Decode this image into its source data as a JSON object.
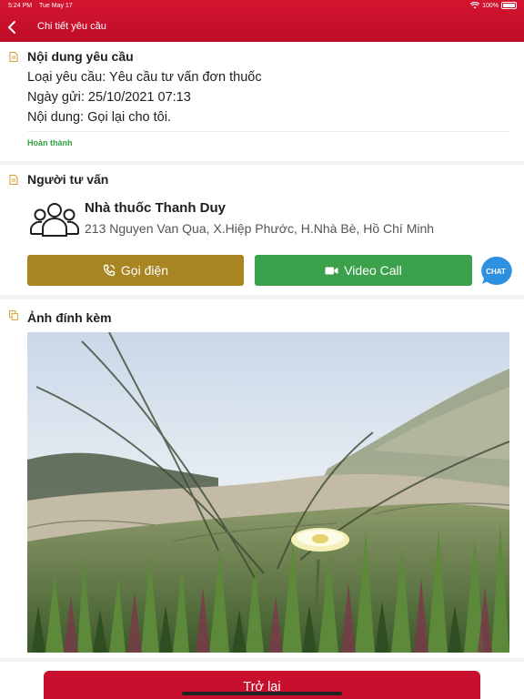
{
  "status_bar": {
    "time": "5:24 PM",
    "date": "Tue May 17",
    "battery": "100%"
  },
  "header": {
    "title": "Chi tiết yêu cầu"
  },
  "request": {
    "title": "Nội dung yêu cầu",
    "type_line": "Loại yêu cầu: Yêu cầu tư vấn đơn thuốc",
    "date_line": "Ngày gửi: 25/10/2021 07:13",
    "content_line": "Nội dung: Gọi lại cho tôi.",
    "status": "Hoàn thành"
  },
  "consultant": {
    "title": "Người tư vấn",
    "name": "Nhà thuốc Thanh Duy",
    "address": "213 Nguyen Van Qua, X.Hiệp Phước, H.Nhà Bè, Hồ Chí Minh",
    "call_label": "Gọi điện",
    "video_label": "Video Call",
    "chat_label": "CHAT"
  },
  "attachments": {
    "title": "Ảnh đính kèm"
  },
  "footer": {
    "back_label": "Trở lại"
  },
  "colors": {
    "brand_red": "#c8102e",
    "call_gold": "#a98521",
    "video_green": "#3ca14b",
    "chat_blue": "#2f8fe0",
    "status_green": "#2e9e3f"
  }
}
